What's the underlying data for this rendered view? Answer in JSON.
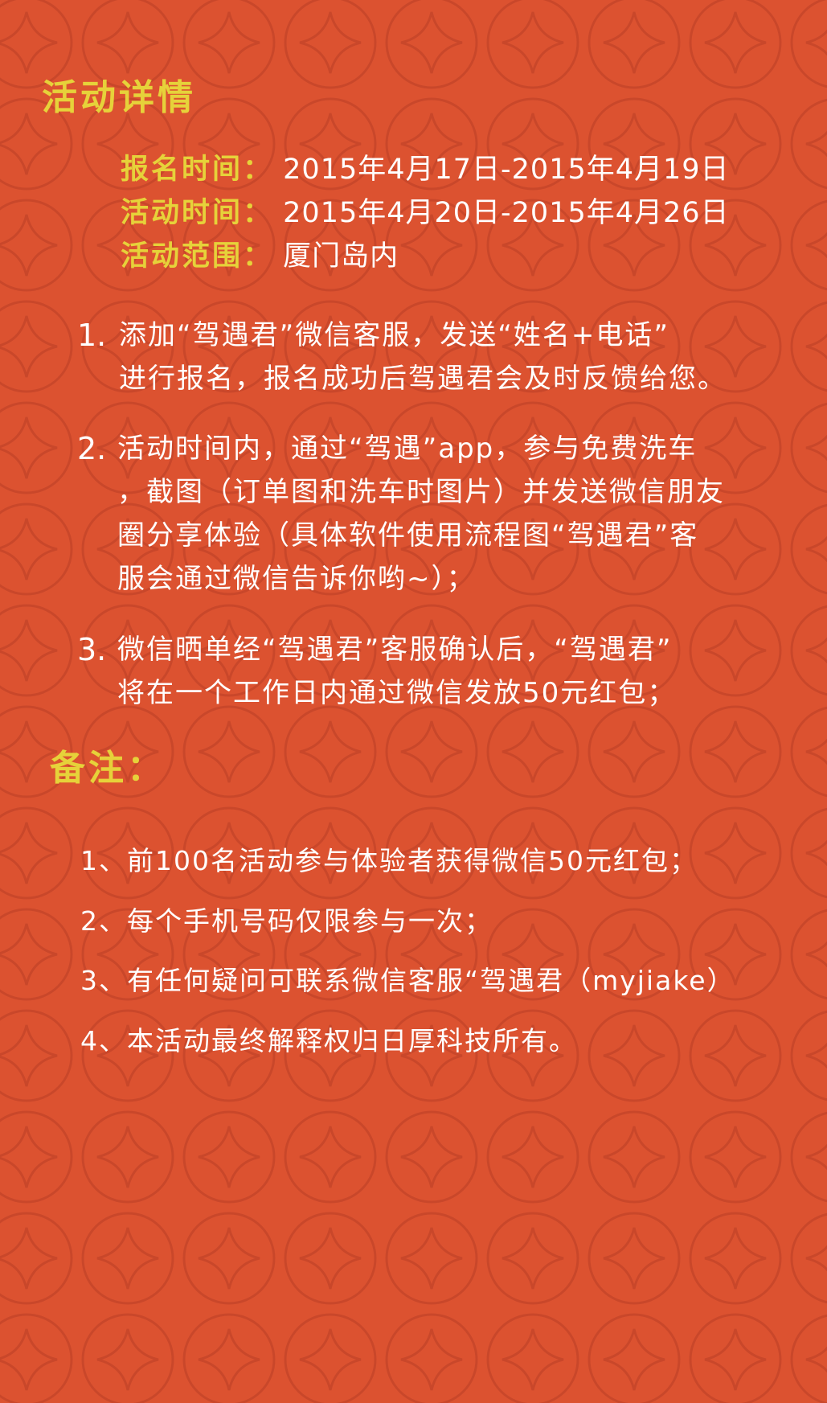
{
  "colors": {
    "background": "#dc5230",
    "pattern": "#c9472a",
    "heading": "#e6d23a",
    "text": "#ffffff"
  },
  "details": {
    "heading": "活动详情",
    "rows": [
      {
        "label": "报名时间：",
        "value": "2015年4月17日-2015年4月19日"
      },
      {
        "label": "活动时间：",
        "value": "2015年4月20日-2015年4月26日"
      },
      {
        "label": "活动范围：",
        "value": "厦门岛内"
      }
    ]
  },
  "steps": [
    {
      "number": "1.",
      "lines": [
        "添加“驾遇君”微信客服，发送“姓名+电话”",
        "进行报名，报名成功后驾遇君会及时反馈给您。"
      ]
    },
    {
      "number": "2.",
      "lines": [
        "活动时间内，通过“驾遇”app，参与免费洗车",
        "，截图（订单图和洗车时图片）并发送微信朋友",
        "圈分享体验（具体软件使用流程图“驾遇君”客",
        "服会通过微信告诉你哟~）；"
      ]
    },
    {
      "number": "3.",
      "lines": [
        "微信晒单经“驾遇君”客服确认后，“驾遇君”",
        "将在一个工作日内通过微信发放50元红包；"
      ]
    }
  ],
  "notes": {
    "heading": "备注：",
    "items": [
      "1、前100名活动参与体验者获得微信50元红包；",
      "2、每个手机号码仅限参与一次；",
      "3、有任何疑问可联系微信客服“驾遇君（myjiake）",
      "4、本活动最终解释权归日厚科技所有。"
    ]
  }
}
